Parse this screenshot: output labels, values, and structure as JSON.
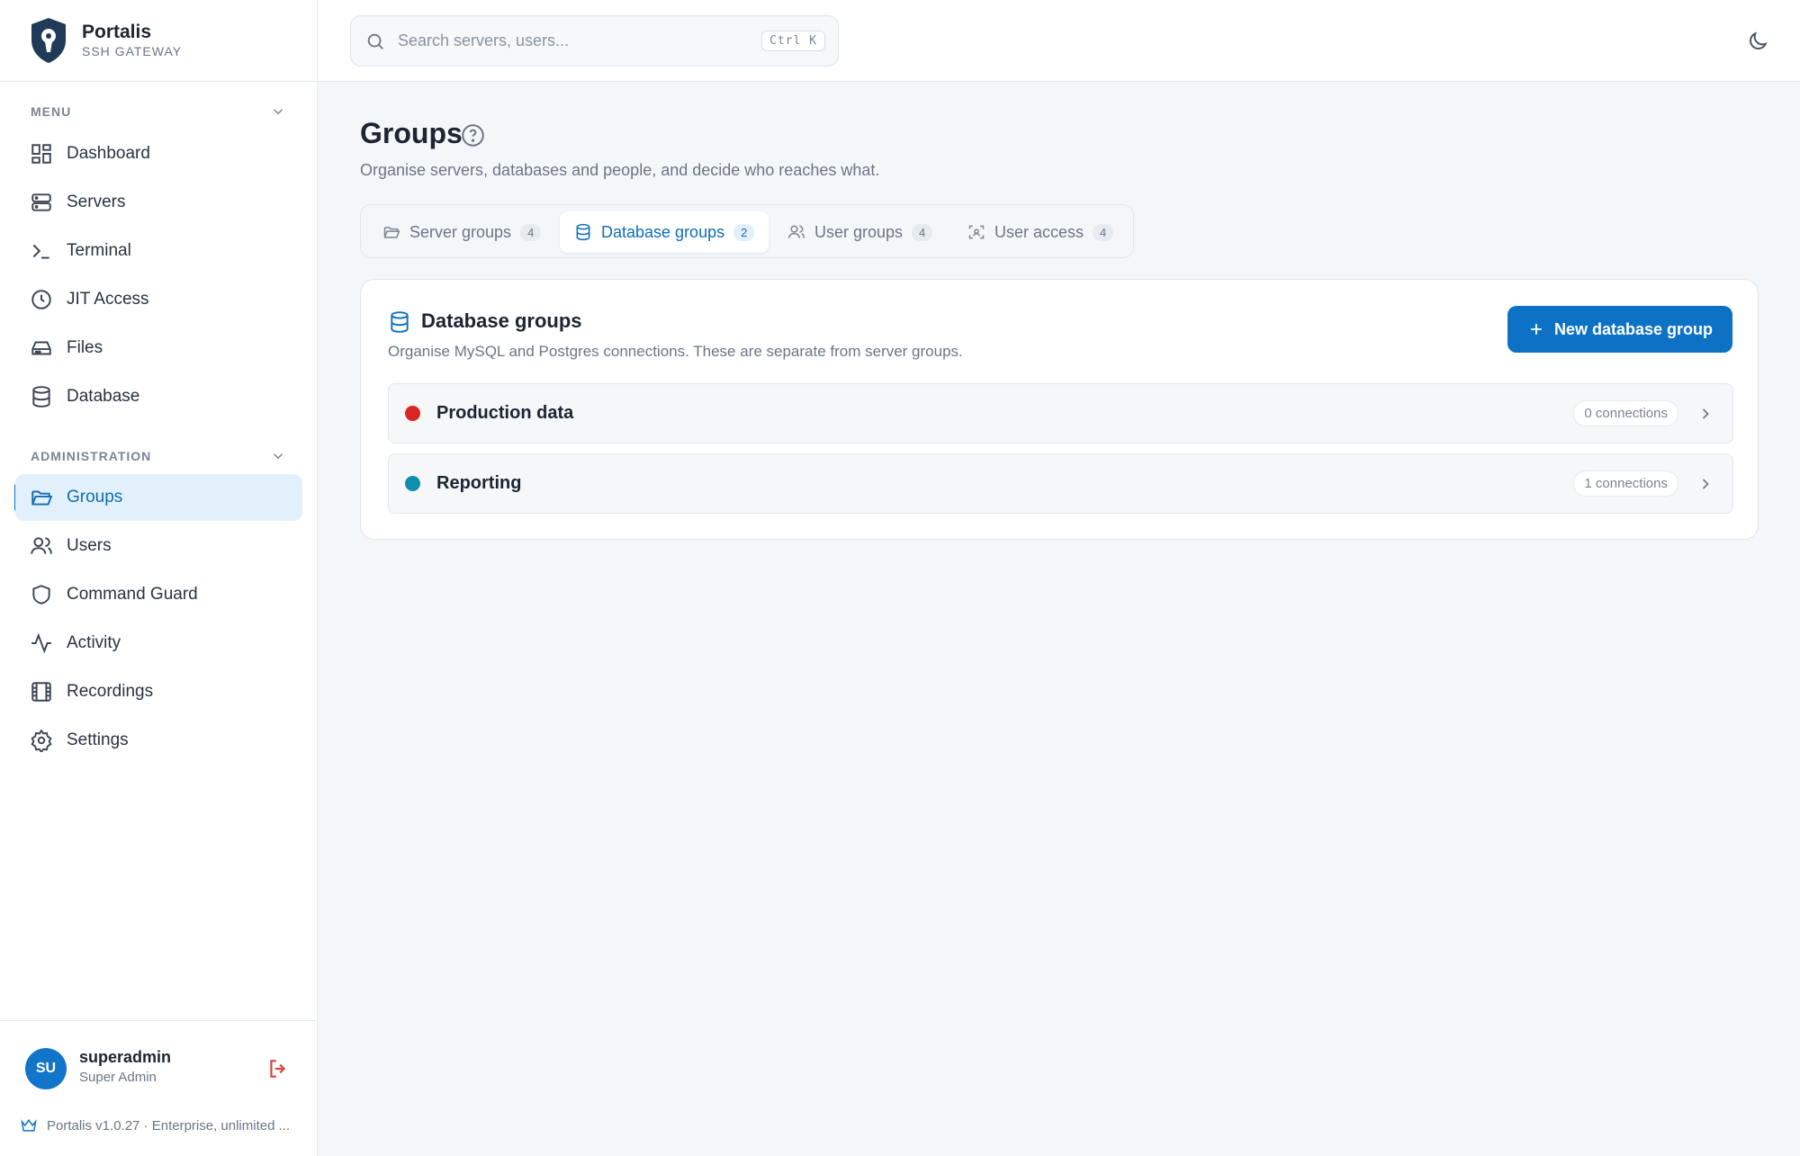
{
  "brand": {
    "name": "Portalis",
    "subtitle": "SSH GATEWAY"
  },
  "sidebar": {
    "menu_label": "MENU",
    "menu_items": [
      {
        "label": "Dashboard",
        "icon": "dashboard-icon"
      },
      {
        "label": "Servers",
        "icon": "server-icon"
      },
      {
        "label": "Terminal",
        "icon": "terminal-icon"
      },
      {
        "label": "JIT Access",
        "icon": "clock-icon"
      },
      {
        "label": "Files",
        "icon": "drive-icon"
      },
      {
        "label": "Database",
        "icon": "database-icon"
      }
    ],
    "admin_label": "ADMINISTRATION",
    "admin_items": [
      {
        "label": "Groups",
        "icon": "folder-open-icon",
        "active": true
      },
      {
        "label": "Users",
        "icon": "users-icon"
      },
      {
        "label": "Command Guard",
        "icon": "shield-icon"
      },
      {
        "label": "Activity",
        "icon": "activity-icon"
      },
      {
        "label": "Recordings",
        "icon": "film-icon"
      },
      {
        "label": "Settings",
        "icon": "gear-icon"
      }
    ],
    "user": {
      "initials": "SU",
      "name": "superadmin",
      "role": "Super Admin"
    },
    "version": "Portalis v1.0.27 · Enterprise, unlimited ..."
  },
  "search": {
    "placeholder": "Search servers, users...",
    "shortcut": "Ctrl K"
  },
  "page": {
    "title": "Groups",
    "subtitle": "Organise servers, databases and people, and decide who reaches what."
  },
  "tabs": [
    {
      "label": "Server groups",
      "count": "4",
      "icon": "folder-icon"
    },
    {
      "label": "Database groups",
      "count": "2",
      "icon": "database-icon",
      "active": true
    },
    {
      "label": "User groups",
      "count": "4",
      "icon": "users-icon"
    },
    {
      "label": "User access",
      "count": "4",
      "icon": "scan-icon"
    }
  ],
  "card": {
    "title": "Database groups",
    "subtitle": "Organise MySQL and Postgres connections. These are separate from server groups.",
    "new_button": "New database group",
    "groups": [
      {
        "name": "Production data",
        "connections": "0 connections",
        "color": "#dc2626"
      },
      {
        "name": "Reporting",
        "connections": "1 connections",
        "color": "#0e8fb0"
      }
    ]
  },
  "colors": {
    "accent": "#0e72c4",
    "active_bg": "#e2f0fb"
  }
}
